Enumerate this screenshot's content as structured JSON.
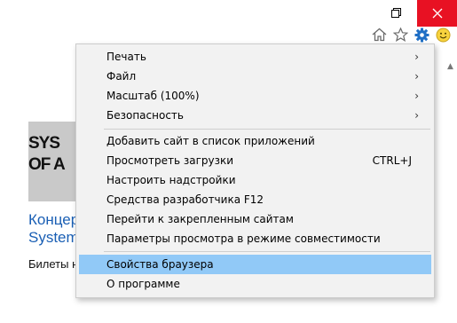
{
  "page": {
    "thumb_lines": [
      "SYS",
      "OF A"
    ],
    "concert_title_line1": "Концер",
    "concert_title_line2": "System",
    "tickets_text": "Билеты н"
  },
  "menu": {
    "items": [
      {
        "label": "Печать",
        "submenu": true
      },
      {
        "label": "Файл",
        "submenu": true
      },
      {
        "label": "Масштаб (100%)",
        "submenu": true
      },
      {
        "label": "Безопасность",
        "submenu": true
      },
      {
        "label": "Добавить сайт в список приложений"
      },
      {
        "label": "Просмотреть загрузки",
        "shortcut": "CTRL+J"
      },
      {
        "label": "Настроить надстройки"
      },
      {
        "label": "Средства разработчика F12"
      },
      {
        "label": "Перейти к закрепленным сайтам"
      },
      {
        "label": "Параметры просмотра в режиме совместимости"
      },
      {
        "label": "Свойства браузера",
        "highlighted": true
      },
      {
        "label": "О программе"
      }
    ],
    "arrow_glyph": "›"
  },
  "colors": {
    "close_button": "#e81123",
    "highlight": "#91c9f7",
    "link": "#1a5fb4"
  }
}
